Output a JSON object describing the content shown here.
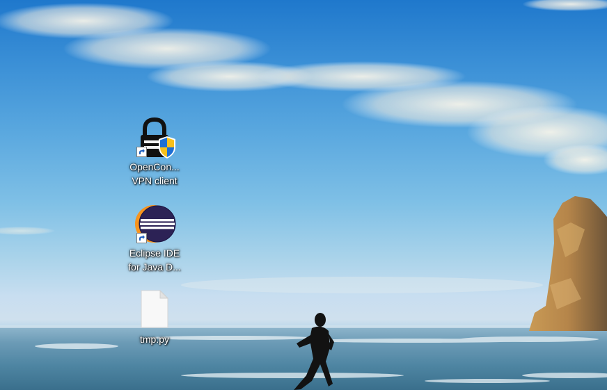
{
  "desktop": {
    "icons": [
      {
        "label": "OpenCon...\nVPN client",
        "icon": "openconnect-vpn-icon",
        "shortcut": true
      },
      {
        "label": "Eclipse IDE\nfor Java D...",
        "icon": "eclipse-ide-icon",
        "shortcut": true
      },
      {
        "label": "tmp.py",
        "icon": "blank-file-icon",
        "shortcut": false
      }
    ]
  },
  "colors": {
    "sky_top": "#1f78cc",
    "sea": "#5b8ea8",
    "eclipse_purple": "#2c2255",
    "eclipse_orange": "#f7941e"
  }
}
